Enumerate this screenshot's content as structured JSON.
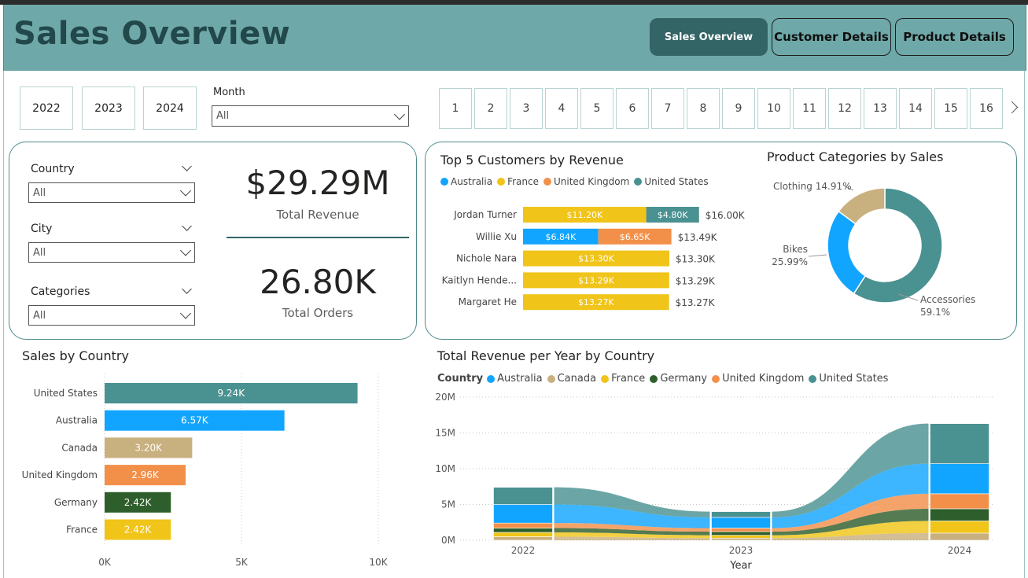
{
  "header": {
    "title": "Sales Overview",
    "nav": [
      {
        "label": "Sales Overview",
        "active": true
      },
      {
        "label": "Customer Details",
        "active": false
      },
      {
        "label": "Product Details",
        "active": false
      }
    ]
  },
  "filters": {
    "years": [
      "2022",
      "2023",
      "2024"
    ],
    "month_label": "Month",
    "month_value": "All",
    "days": [
      "1",
      "2",
      "3",
      "4",
      "5",
      "6",
      "7",
      "8",
      "9",
      "10",
      "11",
      "12",
      "13",
      "14",
      "15",
      "16"
    ]
  },
  "slicers": {
    "country": {
      "label": "Country",
      "value": "All"
    },
    "city": {
      "label": "City",
      "value": "All"
    },
    "categories": {
      "label": "Categories",
      "value": "All"
    }
  },
  "kpis": {
    "revenue_value": "$29.29M",
    "revenue_label": "Total Revenue",
    "orders_value": "26.80K",
    "orders_label": "Total Orders"
  },
  "colors": {
    "Australia": "#12a5ff",
    "Canada": "#c9b07f",
    "France": "#f0c419",
    "Germany": "#2e5e2b",
    "United Kingdom": "#f2904a",
    "United States": "#4a9191",
    "header": "#6fa8a8",
    "nav_active": "#336466"
  },
  "chart_data": [
    {
      "id": "top5",
      "type": "bar",
      "title": "Top 5 Customers by Revenue",
      "legend": [
        "Australia",
        "France",
        "United Kingdom",
        "United States"
      ],
      "categories": [
        "Jordan Turner",
        "Willie Xu",
        "Nichole Nara",
        "Kaitlyn Hende...",
        "Margaret He"
      ],
      "segments": [
        [
          {
            "series": "France",
            "value": 11.2,
            "label": "$11.20K"
          },
          {
            "series": "United States",
            "value": 4.8,
            "label": "$4.80K"
          }
        ],
        [
          {
            "series": "Australia",
            "value": 6.84,
            "label": "$6.84K"
          },
          {
            "series": "United Kingdom",
            "value": 6.65,
            "label": "$6.65K"
          }
        ],
        [
          {
            "series": "France",
            "value": 13.3,
            "label": "$13.30K"
          }
        ],
        [
          {
            "series": "France",
            "value": 13.29,
            "label": "$13.29K"
          }
        ],
        [
          {
            "series": "France",
            "value": 13.27,
            "label": "$13.27K"
          }
        ]
      ],
      "totals": [
        "$16.00K",
        "$13.49K",
        "$13.30K",
        "$13.29K",
        "$13.27K"
      ]
    },
    {
      "id": "donut",
      "type": "pie",
      "title": "Product Categories by Sales",
      "slices": [
        {
          "name": "Accessories",
          "value": 59.1,
          "label": "59.1%",
          "color": "#4a9191"
        },
        {
          "name": "Bikes",
          "value": 25.99,
          "label": "25.99%",
          "color": "#12a5ff"
        },
        {
          "name": "Clothing",
          "value": 14.91,
          "label": "14.91%",
          "color": "#c9b07f"
        }
      ]
    },
    {
      "id": "country",
      "type": "bar",
      "title": "Sales by Country",
      "categories": [
        "United States",
        "Australia",
        "Canada",
        "United Kingdom",
        "Germany",
        "France"
      ],
      "values": [
        9.24,
        6.57,
        3.2,
        2.96,
        2.42,
        2.42
      ],
      "labels": [
        "9.24K",
        "6.57K",
        "3.20K",
        "2.96K",
        "2.42K",
        "2.42K"
      ],
      "xlim": [
        0,
        10
      ],
      "xticks": [
        "0K",
        "5K",
        "10K"
      ]
    },
    {
      "id": "ribbon",
      "type": "area",
      "title": "Total Revenue per Year by Country",
      "legend_title": "Country",
      "legend": [
        "Australia",
        "Canada",
        "France",
        "Germany",
        "United Kingdom",
        "United States"
      ],
      "x": [
        "2022",
        "2023",
        "2024"
      ],
      "xlabel": "Year",
      "ylim": [
        0,
        20
      ],
      "yticks": [
        "0M",
        "5M",
        "10M",
        "15M",
        "20M"
      ],
      "stack_order_bottom_to_top": [
        "Canada",
        "France",
        "Germany",
        "United Kingdom",
        "Australia",
        "United States"
      ],
      "series": [
        {
          "name": "Australia",
          "values": [
            2.6,
            1.5,
            4.2
          ]
        },
        {
          "name": "Canada",
          "values": [
            0.5,
            0.3,
            1.0
          ]
        },
        {
          "name": "France",
          "values": [
            0.6,
            0.4,
            1.7
          ]
        },
        {
          "name": "Germany",
          "values": [
            0.6,
            0.5,
            1.7
          ]
        },
        {
          "name": "United Kingdom",
          "values": [
            0.7,
            0.5,
            2.1
          ]
        },
        {
          "name": "United States",
          "values": [
            2.4,
            0.8,
            5.6
          ]
        }
      ]
    }
  ]
}
